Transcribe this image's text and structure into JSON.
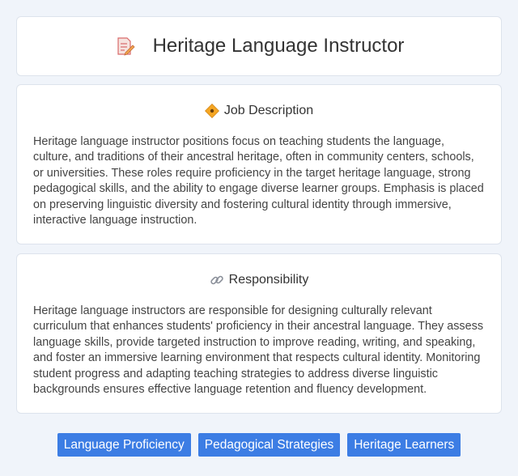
{
  "header": {
    "title": "Heritage Language Instructor",
    "icon": "memo-pencil-icon"
  },
  "sections": [
    {
      "icon": "diamond-icon",
      "title": "Job Description",
      "body": "Heritage language instructor positions focus on teaching students the language, culture, and traditions of their ancestral heritage, often in community centers, schools, or universities. These roles require proficiency in the target heritage language, strong pedagogical skills, and the ability to engage diverse learner groups. Emphasis is placed on preserving linguistic diversity and fostering cultural identity through immersive, interactive language instruction."
    },
    {
      "icon": "link-icon",
      "title": "Responsibility",
      "body": "Heritage language instructors are responsible for designing culturally relevant curriculum that enhances students' proficiency in their ancestral language. They assess language skills, provide targeted instruction to improve reading, writing, and speaking, and foster an immersive learning environment that respects cultural identity. Monitoring student progress and adapting teaching strategies to address diverse linguistic backgrounds ensures effective language retention and fluency development."
    }
  ],
  "tags": [
    "Language Proficiency",
    "Pedagogical Strategies",
    "Heritage Learners"
  ],
  "colors": {
    "accent": "#3c7de4",
    "background": "#f0f4fa",
    "card": "#ffffff"
  }
}
